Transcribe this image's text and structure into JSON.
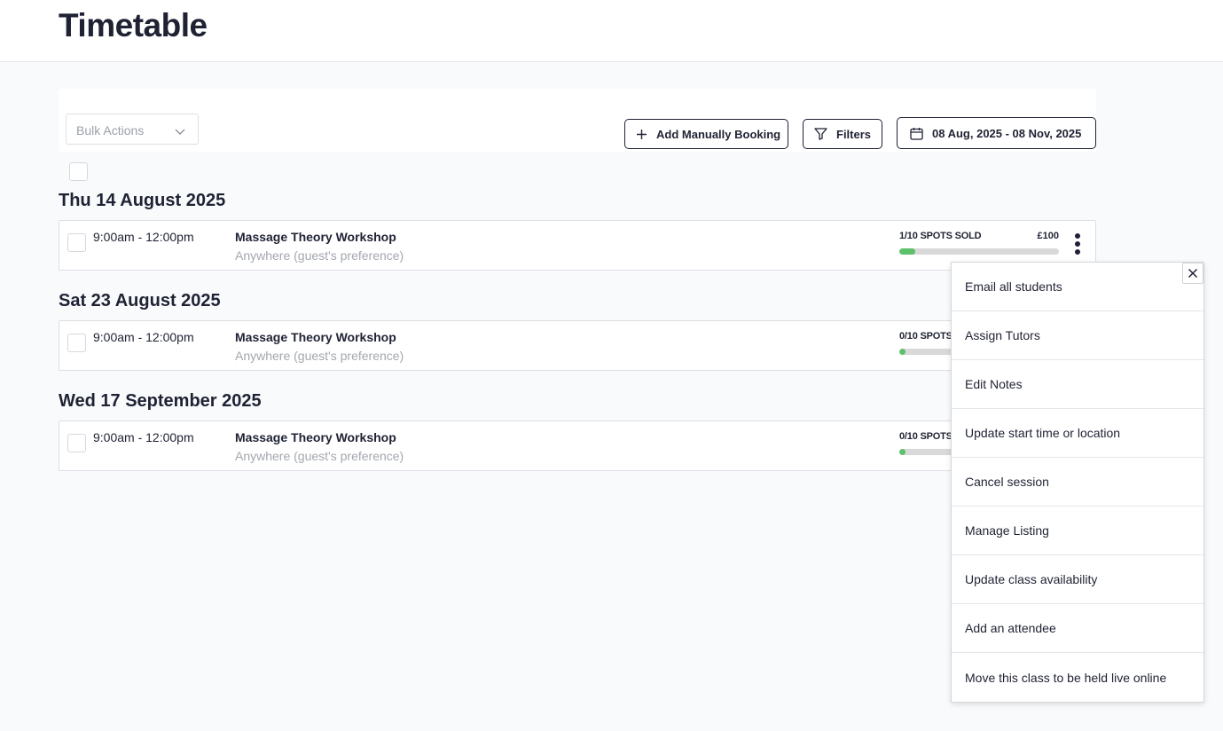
{
  "header": {
    "title": "Timetable"
  },
  "toolbar": {
    "bulk_actions_placeholder": "Bulk Actions",
    "add_booking_label": "Add Manually Booking",
    "filters_label": "Filters",
    "date_range_label": "08 Aug, 2025 - 08 Nov, 2025"
  },
  "days": [
    {
      "heading": "Thu 14 August 2025",
      "session": {
        "time": "9:00am - 12:00pm",
        "name": "Massage Theory Workshop",
        "location": "Anywhere (guest's preference)",
        "spots_label": "1/10 SPOTS SOLD",
        "price": "£100",
        "fill_fraction": 0.1
      }
    },
    {
      "heading": "Sat 23 August 2025",
      "session": {
        "time": "9:00am - 12:00pm",
        "name": "Massage Theory Workshop",
        "location": "Anywhere (guest's preference)",
        "spots_label": "0/10 SPOTS",
        "price": "",
        "fill_fraction": 0
      }
    },
    {
      "heading": "Wed 17 September 2025",
      "session": {
        "time": "9:00am - 12:00pm",
        "name": "Massage Theory Workshop",
        "location": "Anywhere (guest's preference)",
        "spots_label": "0/10 SPOTS",
        "price": "",
        "fill_fraction": 0
      }
    }
  ],
  "context_menu": {
    "items": [
      "Email all students",
      "Assign Tutors",
      "Edit Notes",
      "Update start time or location",
      "Cancel session",
      "Manage Listing",
      "Update class availability",
      "Add an attendee",
      "Move this class to be held live online"
    ]
  },
  "colors": {
    "accent_green": "#5cc16a",
    "text_dark": "#1f2233",
    "muted": "#a3a7ae"
  },
  "icons": [
    "chevron-down-icon",
    "plus-icon",
    "filter-icon",
    "calendar-icon",
    "kebab-icon",
    "close-icon"
  ]
}
